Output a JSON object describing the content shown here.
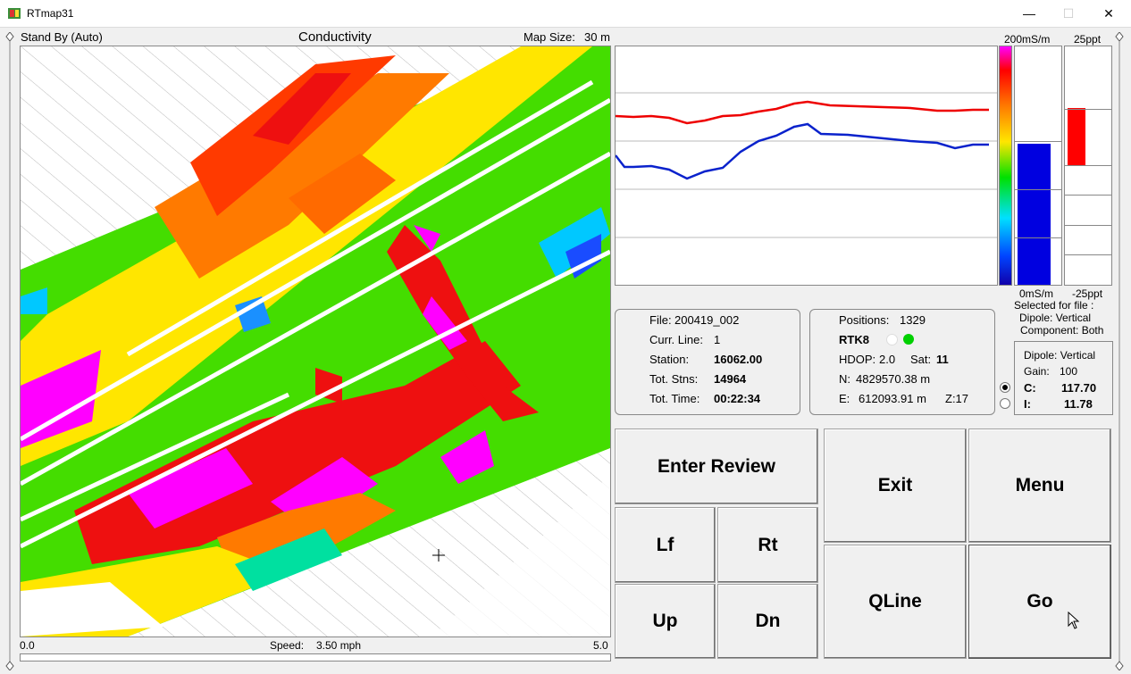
{
  "window": {
    "title": "RTmap31",
    "minimize": "—",
    "maximize": "☐",
    "close": "✕"
  },
  "map_header": {
    "status": "Stand By (Auto)",
    "title": "Conductivity",
    "map_size_label": "Map Size:",
    "map_size_value": "30 m"
  },
  "map_footer": {
    "left": "0.0",
    "speed_label": "Speed:",
    "speed_value": "3.50 mph",
    "right": "5.0"
  },
  "scales": {
    "cond_top": "200mS/m",
    "cond_bottom": "0mS/m",
    "ip_top": "25ppt",
    "ip_bottom": "-25ppt",
    "cond_level": 0.59,
    "ip_top_level": 0.74,
    "ip_bottom_level": 0.5
  },
  "selected": {
    "line1": "Selected for file :",
    "line2": "Dipole: Vertical",
    "line3": "Component: Both"
  },
  "file_panel": {
    "file_label": "File:",
    "file_value": "200419_002",
    "curr_line_label": "Curr. Line:",
    "curr_line_value": "1",
    "station_label": "Station:",
    "station_value": "16062.00",
    "tot_stns_label": "Tot. Stns:",
    "tot_stns_value": "14964",
    "tot_time_label": "Tot. Time:",
    "tot_time_value": "00:22:34"
  },
  "gps_panel": {
    "positions_label": "Positions:",
    "positions_value": "1329",
    "rtk_label": "RTK8",
    "hdop_label": "HDOP:",
    "hdop_value": "2.0",
    "sat_label": "Sat:",
    "sat_value": "11",
    "n_label": "N:",
    "n_value": "4829570.38 m",
    "e_label": "E:",
    "e_value": "612093.91 m",
    "z_label": "Z:17"
  },
  "dipole_panel": {
    "dipole": "Dipole: Vertical",
    "gain_label": "Gain:",
    "gain_value": "100",
    "c_label": "C:",
    "c_value": "117.70",
    "i_label": "I:",
    "i_value": "11.78"
  },
  "buttons": {
    "enter_review_pre": "Enter Re",
    "enter_review_ul": "v",
    "enter_review_post": "iew",
    "exit_pre": "E",
    "exit_ul": "x",
    "exit_post": "it",
    "menu_ul": "M",
    "menu_post": "enu",
    "lf_ul": "L",
    "lf_post": "f",
    "rt_ul": "R",
    "rt_post": "t",
    "qline_ul": "Q",
    "qline_post": "Line",
    "up_ul": "U",
    "up_post": "p",
    "dn_ul": "D",
    "dn_post": "n",
    "go_ul": "G",
    "go_post": "o"
  }
}
